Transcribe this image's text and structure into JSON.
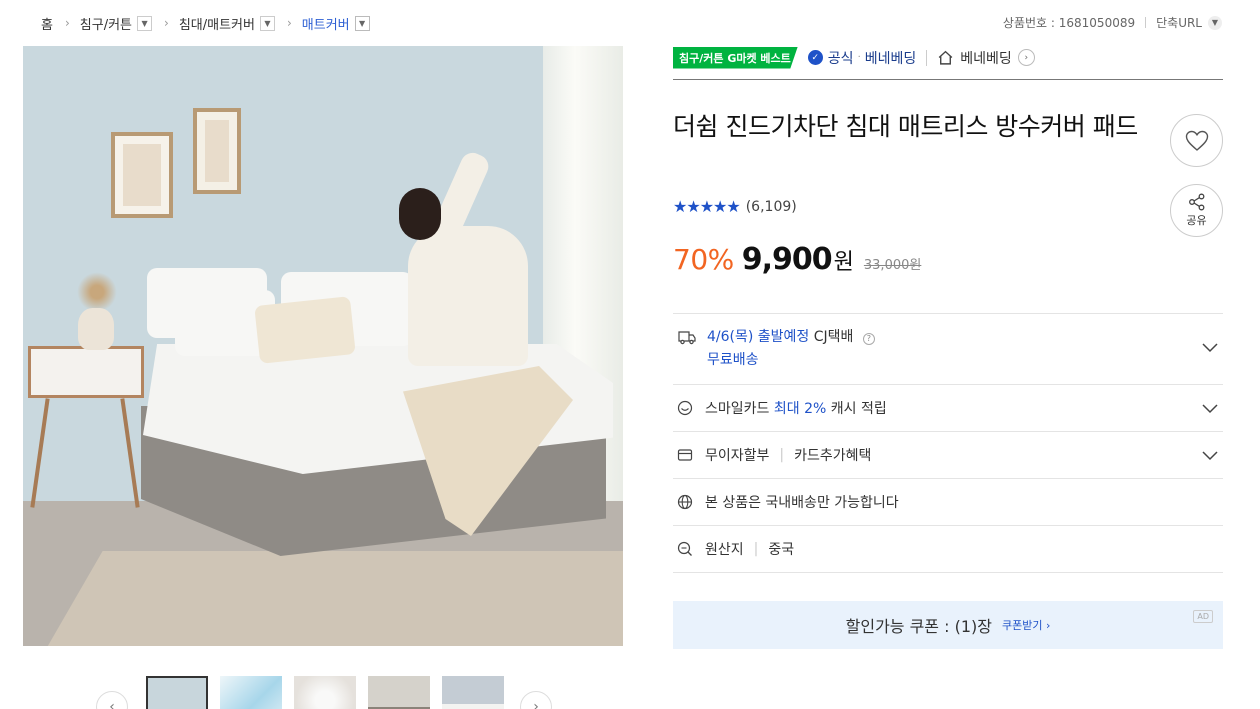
{
  "breadcrumb": {
    "home": "홈",
    "cat1": "침구/커튼",
    "cat2": "침대/매트커버",
    "cat3": "매트커버"
  },
  "topright": {
    "product_no": "상품번호 : 1681050089",
    "short_url": "단축URL"
  },
  "seller": {
    "badge": "침구/커튼 G마켓 베스트",
    "official": "공식",
    "official_name": "베네베딩",
    "store_name": "베네베딩"
  },
  "product": {
    "title": "더쉼 진드기차단 침대 매트리스 방수커버 패드",
    "rating_stars": "★★★★★",
    "review_count": "(6,109)",
    "rating": 4.5,
    "discount": "70%",
    "price": "9,900",
    "won": "원",
    "original_price": "33,000원"
  },
  "actions": {
    "share_label": "공유"
  },
  "info": {
    "delivery_date": "4/6(목) 출발예정",
    "delivery_carrier": "CJ택배",
    "delivery_fee": "무료배송",
    "smile_prefix": "스마일카드",
    "smile_highlight": "최대 2%",
    "smile_suffix": "캐시 적립",
    "installment": "무이자할부",
    "card_benefit": "카드추가혜택",
    "domestic": "본 상품은 국내배송만 가능합니다",
    "origin_label": "원산지",
    "origin_value": "중국"
  },
  "coupon": {
    "text": "할인가능 쿠폰 : (1)장",
    "link": "쿠폰받기 ›",
    "ad": "AD"
  },
  "colors": {
    "accent_blue": "#1f52c8",
    "discount_orange": "#f26522",
    "best_green": "#00b340",
    "coupon_bg": "#e9f2fc"
  }
}
